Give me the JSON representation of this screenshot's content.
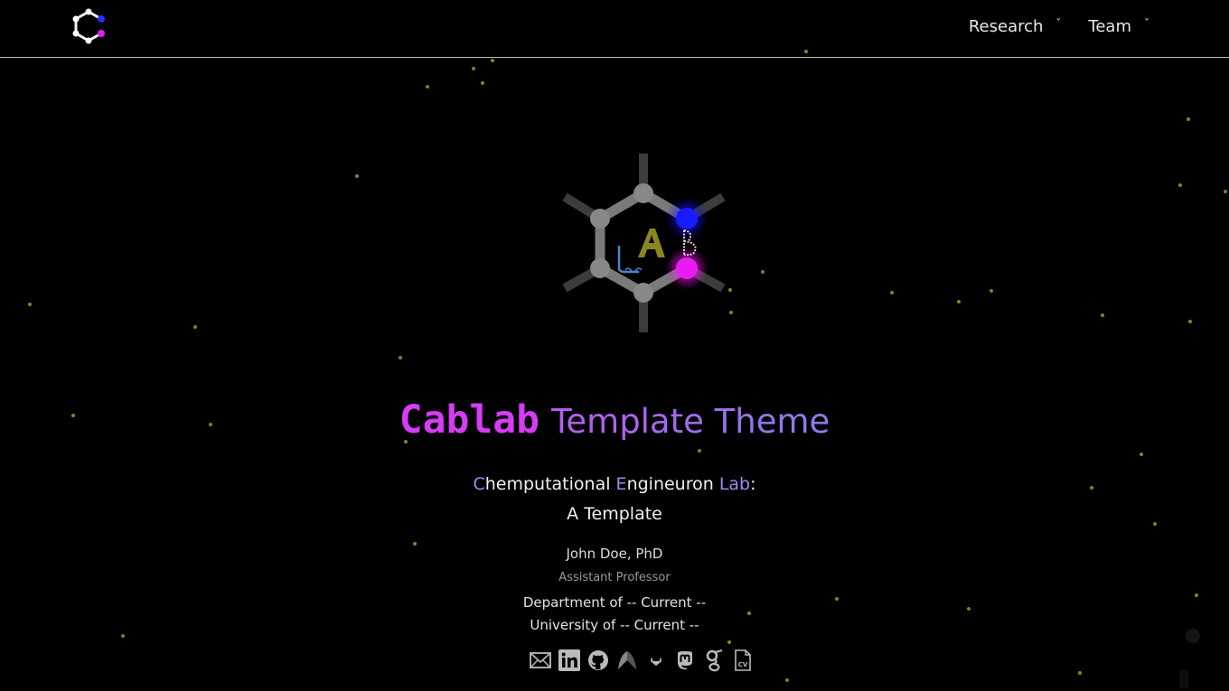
{
  "nav": {
    "items": [
      {
        "label": "Research",
        "chevron": "ˇ"
      },
      {
        "label": "Team",
        "chevron": "ˇ"
      }
    ]
  },
  "hero": {
    "title_brand": "Cablab",
    "title_rest": "Template Theme",
    "subtitle": {
      "c_initial": "C",
      "c_rest": "hemputational",
      "e_initial": "E",
      "e_rest": "ngineuron",
      "lab": "Lab",
      "colon": ":",
      "line2": "A Template"
    }
  },
  "person": {
    "name": "John Doe, PhD",
    "role": "Assistant Professor",
    "department": "Department of -- Current --",
    "university": "University of -- Current --"
  },
  "socials": [
    {
      "icon": "email-icon"
    },
    {
      "icon": "linkedin-icon"
    },
    {
      "icon": "github-icon"
    },
    {
      "icon": "researchgate-peak-icon"
    },
    {
      "icon": "gitlab-icon"
    },
    {
      "icon": "mastodon-icon"
    },
    {
      "icon": "google-scholar-icon"
    },
    {
      "icon": "cv-file-icon",
      "label": "CV"
    }
  ],
  "colors": {
    "background": "#000000",
    "brand_magenta": "#d63cf5",
    "accent_violet": "#9c8cf0",
    "node_blue": "#2222ff",
    "node_magenta": "#e020f0",
    "particle": "#8a8a1e"
  }
}
